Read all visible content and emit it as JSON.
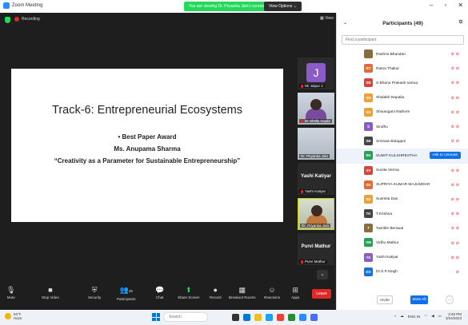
{
  "window": {
    "title": "Zoom Meeting",
    "share_banner": "You are viewing Dr. Priyanka Jain's screen",
    "view_options": "View Options",
    "view_label": "View"
  },
  "meeting": {
    "recording": "Recording"
  },
  "slide": {
    "title": "Track-6: Entrepreneurial Ecosystems",
    "line1": "• Best Paper Award",
    "line2": "Ms. Anupama Sharma",
    "line3": "“Creativity as a Parameter for Sustainable Entrepreneurship”"
  },
  "tiles": [
    {
      "initial": "J",
      "name": "IIE Jaipur 2"
    },
    {
      "name": "Dr Shelly Gupta"
    },
    {
      "name": "Dr. Priyanka Jain"
    },
    {
      "big": "Yashi Katiyar",
      "name": "Yashi Katiyar"
    },
    {
      "name": "Dr. Priyanka Jain"
    },
    {
      "big": "Purvi Mathur",
      "name": "Purvi Mathur"
    }
  ],
  "toolbar": {
    "mute": "Mute",
    "stop_video": "Stop Video",
    "security": "Security",
    "participants": "Participants",
    "participants_count": "49",
    "chat": "Chat",
    "share_screen": "Share Screen",
    "record": "Record",
    "breakout": "Breakout Rooms",
    "reactions": "Reactions",
    "apps": "Apps",
    "leave": "Leave"
  },
  "panel": {
    "title": "Participants (49)",
    "search_placeholder": "Find a participant",
    "ask_unmute": "Ask to Unmute",
    "invite": "Invite",
    "mute_all": "Mute All",
    "more": "···",
    "participants": [
      {
        "initials": "",
        "name": "Rashmi Bhandari",
        "color": "#8a6d3b"
      },
      {
        "initials": "RT",
        "name": "Ratna Thakur",
        "color": "#e86a33"
      },
      {
        "initials": "SB",
        "name": "S Bhanu Prakash sarma",
        "color": "#d9443a"
      },
      {
        "initials": "SN",
        "name": "Shalabh Napalia",
        "color": "#f0a030"
      },
      {
        "initials": "SR",
        "name": "Shivangani Rathore",
        "color": "#f0a030"
      },
      {
        "initials": "S",
        "name": "Sindhu",
        "color": "#8b5cc7"
      },
      {
        "initials": "SB",
        "name": "Srinivas Bolagani",
        "color": "#444444"
      },
      {
        "initials": "SK",
        "name": "SUMIT KULSHRESTHA",
        "color": "#23a455"
      },
      {
        "initials": "SV",
        "name": "Sunita Verma",
        "color": "#d9443a"
      },
      {
        "initials": "SK",
        "name": "SUPRIYA KUMAR MAJUMDAR",
        "color": "#e86a33"
      },
      {
        "initials": "SD",
        "name": "Susmita Das",
        "color": "#f0a030"
      },
      {
        "initials": "TK",
        "name": "T.Krishna",
        "color": "#444444"
      },
      {
        "initials": "T",
        "name": "Twinkle Beniwal",
        "color": "#8a6d3b"
      },
      {
        "initials": "VM",
        "name": "Vidhu Mathur",
        "color": "#23a455"
      },
      {
        "initials": "YK",
        "name": "Yashi Katiyar",
        "color": "#8b5cc7"
      },
      {
        "initials": "DS",
        "name": "Dr.S.P.Singh",
        "color": "#0e71eb"
      }
    ]
  },
  "taskbar": {
    "temp": "83°F",
    "weather": "Haze",
    "search": "Search",
    "lang": "ENG",
    "region": "IN",
    "time": "2:46 PM",
    "date": "3/24/2023"
  }
}
